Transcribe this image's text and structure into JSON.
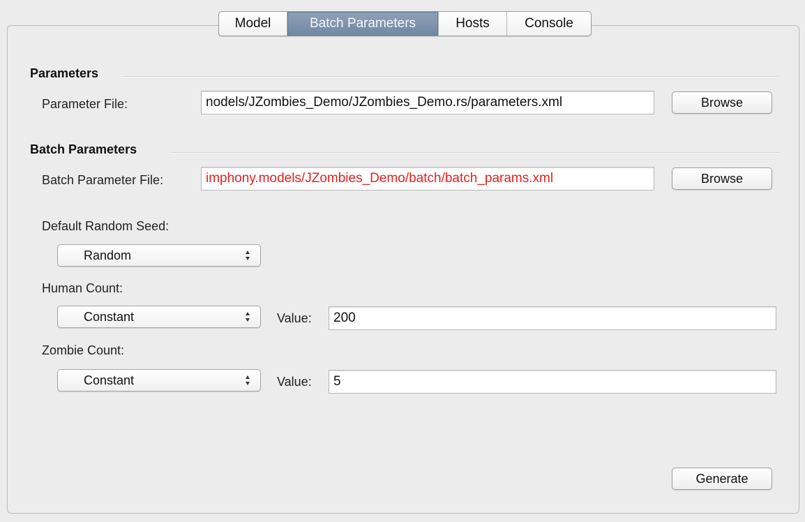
{
  "tabs": [
    {
      "label": "Model",
      "selected": false
    },
    {
      "label": "Batch Parameters",
      "selected": true
    },
    {
      "label": "Hosts",
      "selected": false
    },
    {
      "label": "Console",
      "selected": false
    }
  ],
  "parameters_section": {
    "title": "Parameters",
    "file_label": "Parameter File:",
    "file_value": "nodels/JZombies_Demo/JZombies_Demo.rs/parameters.xml",
    "browse_label": "Browse"
  },
  "batch_section": {
    "title": "Batch Parameters",
    "file_label": "Batch Parameter File:",
    "file_value": "imphony.models/JZombies_Demo/batch/batch_params.xml",
    "browse_label": "Browse"
  },
  "random_seed": {
    "label": "Default Random Seed:",
    "selected": "Random"
  },
  "human_count": {
    "label": "Human Count:",
    "selected": "Constant",
    "value_label": "Value:",
    "value": "200"
  },
  "zombie_count": {
    "label": "Zombie Count:",
    "selected": "Constant",
    "value_label": "Value:",
    "value": "5"
  },
  "generate_label": "Generate",
  "colors": {
    "error_text": "#e8201e",
    "selected_tab": "#7f94ad",
    "background": "#ececec"
  }
}
